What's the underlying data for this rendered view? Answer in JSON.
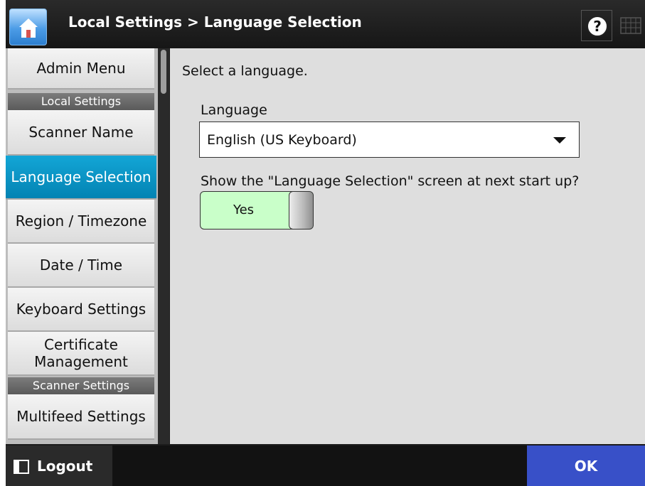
{
  "header": {
    "title": "Local Settings > Language Selection",
    "home_icon": "home-icon",
    "help_icon": "help-icon",
    "keyboard_icon": "keyboard-icon"
  },
  "sidebar": {
    "items": [
      {
        "label": "Admin Menu"
      },
      {
        "label": "Scanner Name"
      },
      {
        "label": "Language Selection",
        "selected": true
      },
      {
        "label": "Region / Timezone"
      },
      {
        "label": "Date / Time"
      },
      {
        "label": "Keyboard Settings"
      },
      {
        "label": "Certificate Management"
      },
      {
        "label": "Multifeed Settings"
      }
    ],
    "sections": {
      "local": "Local Settings",
      "scanner": "Scanner Settings"
    },
    "selected_color": "#0a95c6"
  },
  "content": {
    "prompt": "Select a language.",
    "language_label": "Language",
    "language_value": "English (US Keyboard)",
    "show_label": "Show the \"Language Selection\" screen at next start up?",
    "toggle_value": "Yes",
    "toggle_color": "#c9ffc9"
  },
  "footer": {
    "logout_label": "Logout",
    "ok_label": "OK",
    "ok_color": "#3850c8"
  }
}
